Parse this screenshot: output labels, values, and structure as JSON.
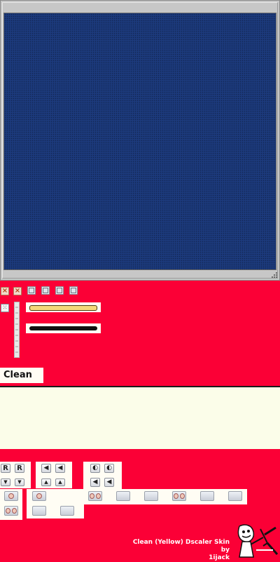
{
  "skin": {
    "logo_text": "Clean",
    "credit_line1": "Clean (Yellow) Dscaler Skin",
    "credit_line2": "by",
    "credit_line3": "1ijack"
  },
  "buttons": {
    "r_label": "R"
  },
  "colors": {
    "background": "#fb0036",
    "video": "#1c3a7c",
    "cream": "#fbfde9",
    "slider_yellow": "#f5d97a",
    "slider_black": "#111111"
  },
  "icons": {
    "close": "close-icon",
    "minimize": "minimize-icon",
    "restore": "restore-icon",
    "maximize": "maximize-icon",
    "fullscreen": "fullscreen-icon",
    "arrow_up": "arrow-up-icon",
    "arrow_down": "arrow-down-icon"
  }
}
